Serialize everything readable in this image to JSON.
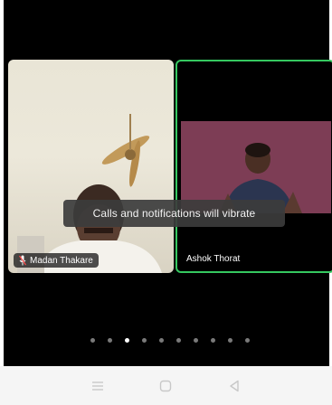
{
  "participants": [
    {
      "name": "Madan Thakare",
      "muted": true,
      "active_speaker": false
    },
    {
      "name": "Ashok Thorat",
      "muted": false,
      "active_speaker": true
    }
  ],
  "toast": {
    "message": "Calls and notifications will vibrate"
  },
  "pagination": {
    "total": 10,
    "active_index": 2
  },
  "nav": {
    "menu_icon": "menu-icon",
    "home_icon": "home-icon",
    "back_icon": "back-icon"
  },
  "colors": {
    "active_speaker_border": "#35c860",
    "call_background": "#000000",
    "nav_background": "#f5f5f5"
  }
}
